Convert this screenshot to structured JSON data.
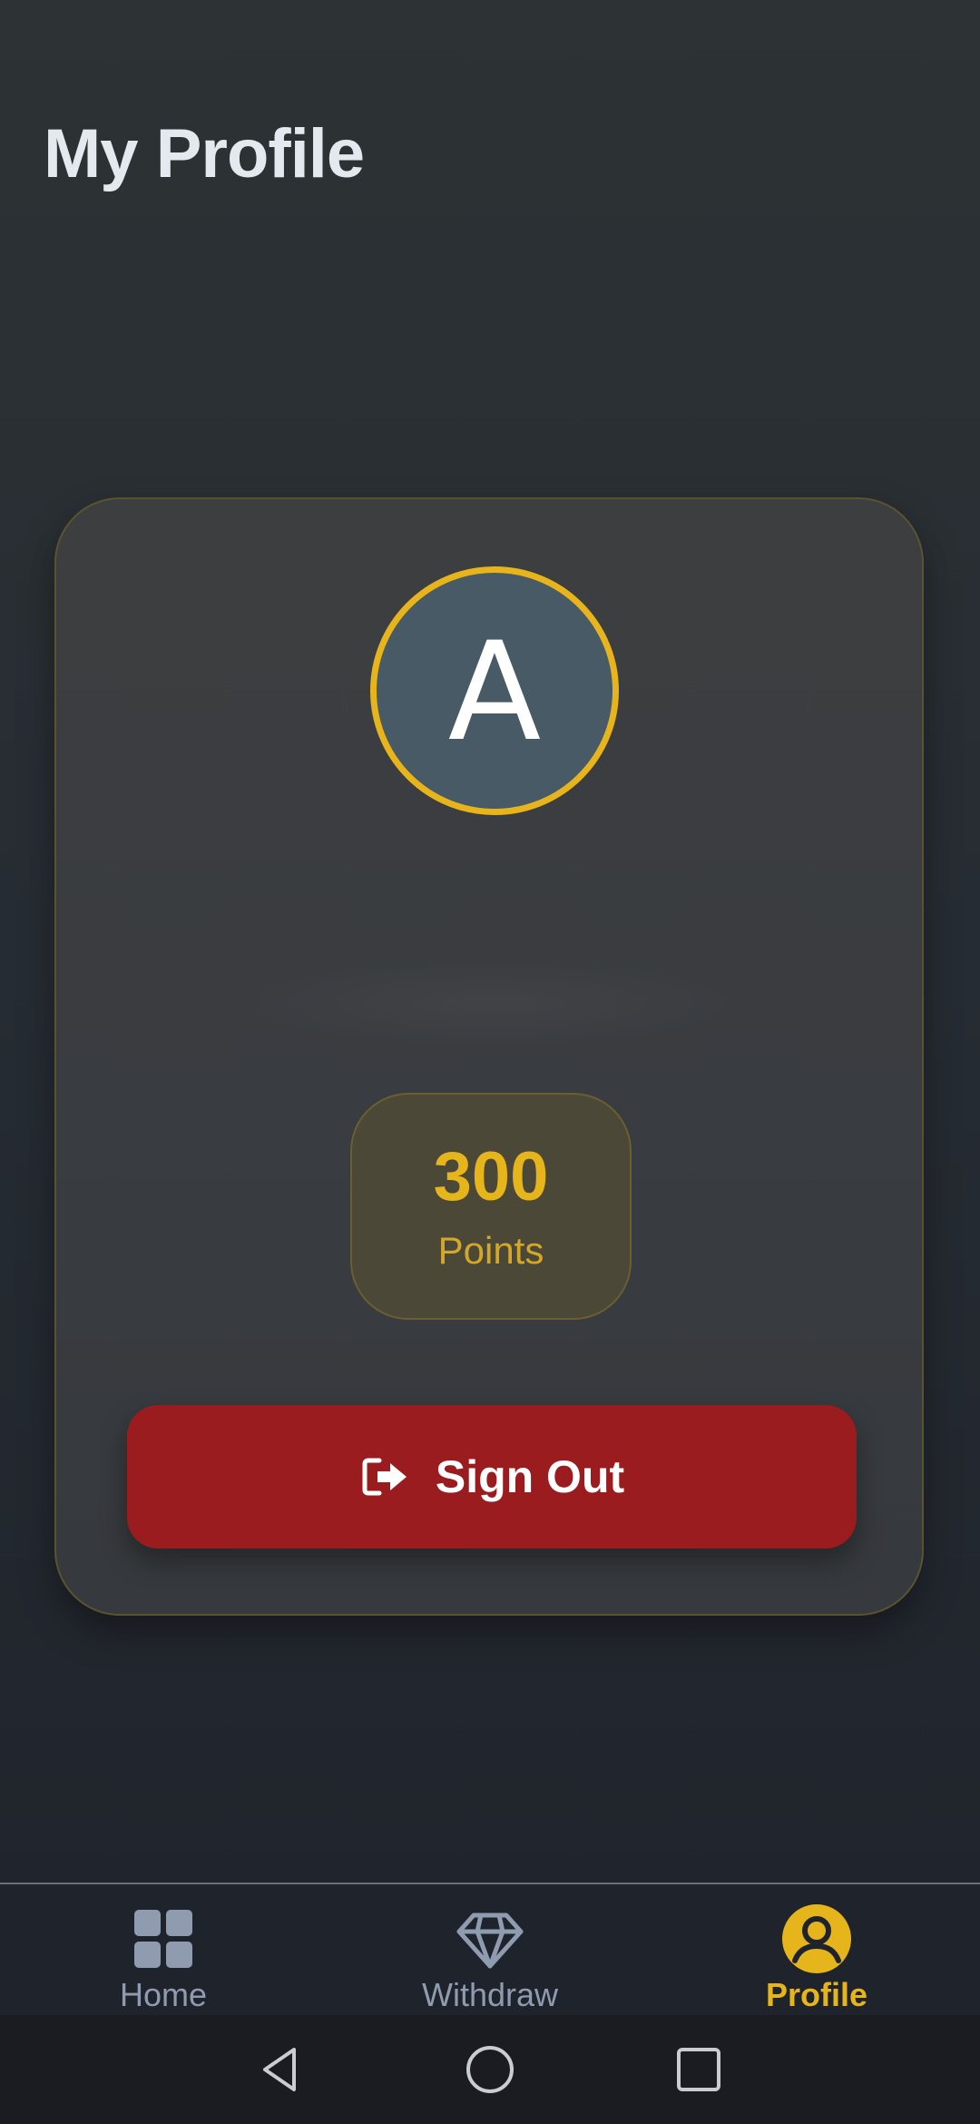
{
  "header": {
    "title": "My Profile"
  },
  "profile": {
    "avatar_letter": "A",
    "points_value": "300",
    "points_label": "Points",
    "signout_label": "Sign Out"
  },
  "bottom_nav": {
    "items": [
      {
        "label": "Home",
        "icon": "grid-icon",
        "active": false
      },
      {
        "label": "Withdraw",
        "icon": "diamond-icon",
        "active": false
      },
      {
        "label": "Profile",
        "icon": "user-circle-icon",
        "active": true
      }
    ]
  },
  "colors": {
    "accent": "#e6b51b",
    "danger": "#9b1c1e",
    "inactive": "#8f9cb0",
    "avatar_bg": "#485a66"
  },
  "system_nav": {
    "icons": [
      "back-icon",
      "home-circle-icon",
      "recents-icon"
    ]
  }
}
